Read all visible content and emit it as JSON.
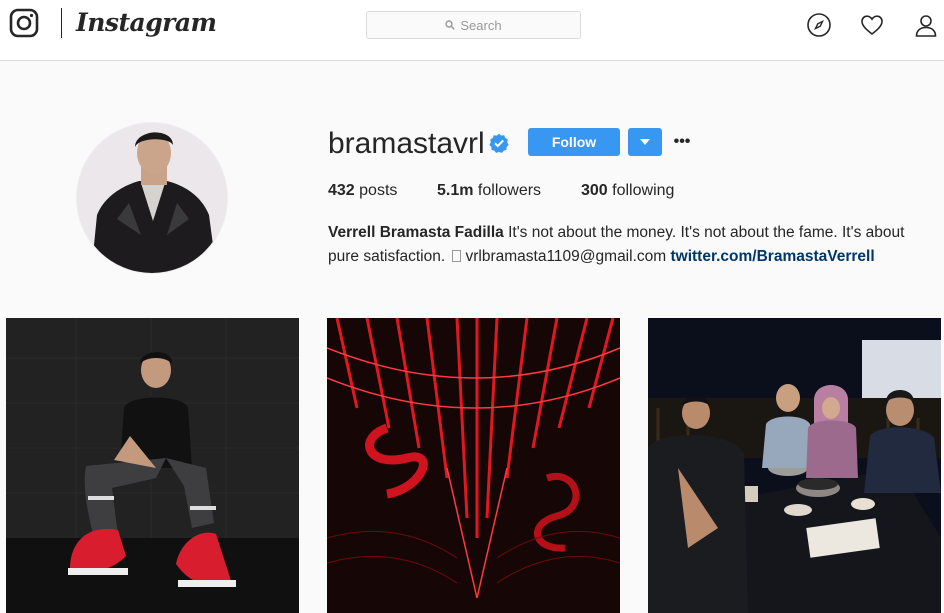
{
  "nav": {
    "wordmark": "Instagram",
    "search_placeholder": "Search",
    "icons": [
      "instagram-glyph-icon",
      "search-icon",
      "compass-icon",
      "heart-icon",
      "person-icon"
    ]
  },
  "profile": {
    "username": "bramastavrl",
    "verified": true,
    "follow_label": "Follow",
    "more_label": "•••",
    "stats": {
      "posts_count": "432",
      "posts_label": "posts",
      "followers_count": "5.1m",
      "followers_label": "followers",
      "following_count": "300",
      "following_label": "following"
    },
    "bio": {
      "full_name": "Verrell Bramasta Fadilla",
      "text": "It's not about the money. It's not about the fame. It's about pure satisfaction.",
      "email": "vrlbramasta1109@gmail.com",
      "link": "twitter.com/BramastaVerrell"
    }
  },
  "colors": {
    "accent": "#3897f0",
    "link": "#003569",
    "text": "#262626",
    "border": "#dbdbdb",
    "background": "#fafafa"
  },
  "posts": [
    {
      "subject": "man-sitting-red-sneakers"
    },
    {
      "subject": "red-abstract-art"
    },
    {
      "subject": "group-dinner-photo"
    }
  ]
}
